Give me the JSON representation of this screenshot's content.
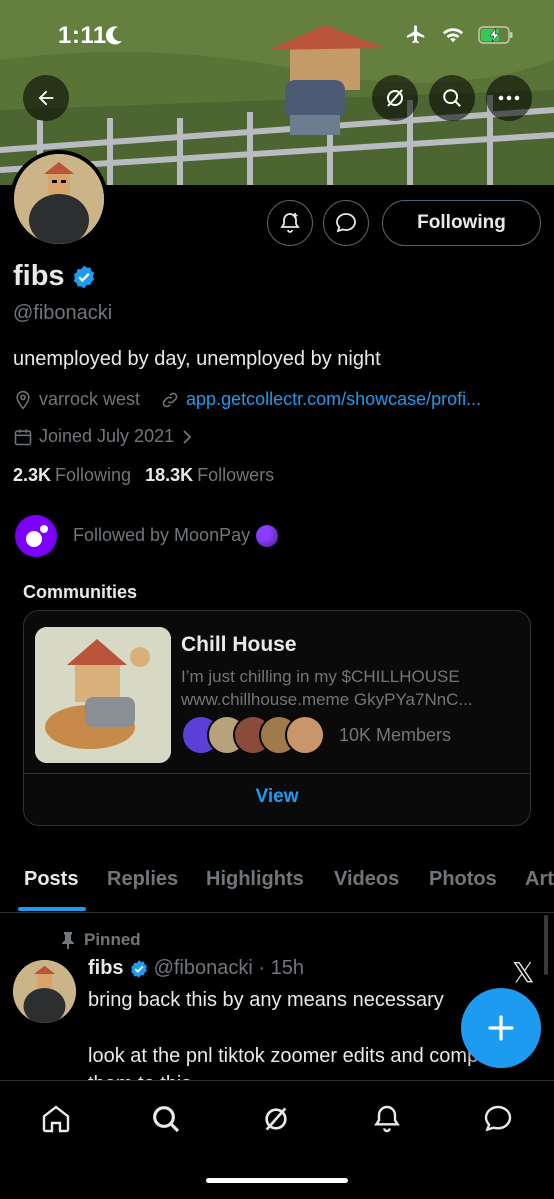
{
  "status_bar": {
    "time": "1:11"
  },
  "profile": {
    "name": "fibs",
    "handle": "@fibonacki",
    "bio": "unemployed by day, unemployed by night",
    "location": "varrock west",
    "website": "app.getcollectr.com/showcase/profi...",
    "joined": "Joined July 2021",
    "following_count": "2.3K",
    "following_label": "Following",
    "followers_count": "18.3K",
    "followers_label": "Followers",
    "follow_button_label": "Following",
    "followed_by": "Followed by MoonPay"
  },
  "communities": {
    "label": "Communities",
    "card": {
      "name": "Chill House",
      "description_line1": "I’m just chilling in my $CHILLHOUSE",
      "description_line2": "www.chillhouse.meme GkyPYa7NnC...",
      "members": "10K Members",
      "view_label": "View"
    }
  },
  "tabs": [
    "Posts",
    "Replies",
    "Highlights",
    "Videos",
    "Photos",
    "Art"
  ],
  "post": {
    "pinned_label": "Pinned",
    "author": "fibs",
    "handle_time": "@fibonacki · 15h",
    "line1": "bring back this by any means necessary",
    "line2": "look at the pnl tiktok zoomer edits and compare",
    "line3": "them to this"
  },
  "colors": {
    "accent": "#1d9bf0",
    "background": "#000000",
    "muted": "#71767b",
    "moonpay": "#7d00ff"
  },
  "icons": [
    "back-arrow-icon",
    "grok-icon",
    "search-icon",
    "more-icon",
    "notification-add-icon",
    "message-icon",
    "verified-icon",
    "location-icon",
    "link-icon",
    "calendar-icon",
    "chevron-right-icon",
    "pin-icon",
    "x-logo-icon",
    "plus-icon",
    "home-icon",
    "bell-icon"
  ]
}
